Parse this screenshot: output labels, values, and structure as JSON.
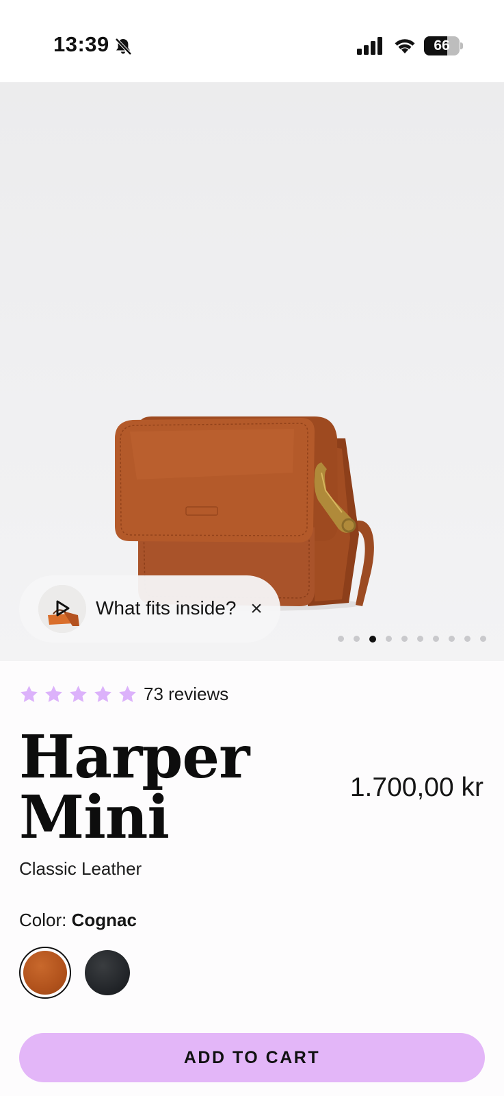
{
  "status_bar": {
    "time": "13:39",
    "battery_level": "66",
    "icons": [
      "bell-slash-icon",
      "signal-icon",
      "wifi-icon",
      "battery-icon"
    ]
  },
  "gallery": {
    "fits_inside_label": "What fits inside?",
    "close_glyph": "×",
    "image_count": 10,
    "active_index": 2
  },
  "product": {
    "rating": 5,
    "review_count_label": "73 reviews",
    "title_line1": "Harper",
    "title_line2": "Mini",
    "price": "1.700,00 kr",
    "subtitle": "Classic Leather",
    "color_label": "Color:",
    "color_value": "Cognac",
    "swatches": [
      {
        "name": "Cognac",
        "color": "#b3561f",
        "selected": true
      },
      {
        "name": "Black",
        "color": "#23262a",
        "selected": false
      }
    ]
  },
  "actions": {
    "add_to_cart_label": "ADD TO CART"
  },
  "colors": {
    "accent": "#e3b6f8",
    "star": "#dcb2fb",
    "text": "#111111"
  }
}
